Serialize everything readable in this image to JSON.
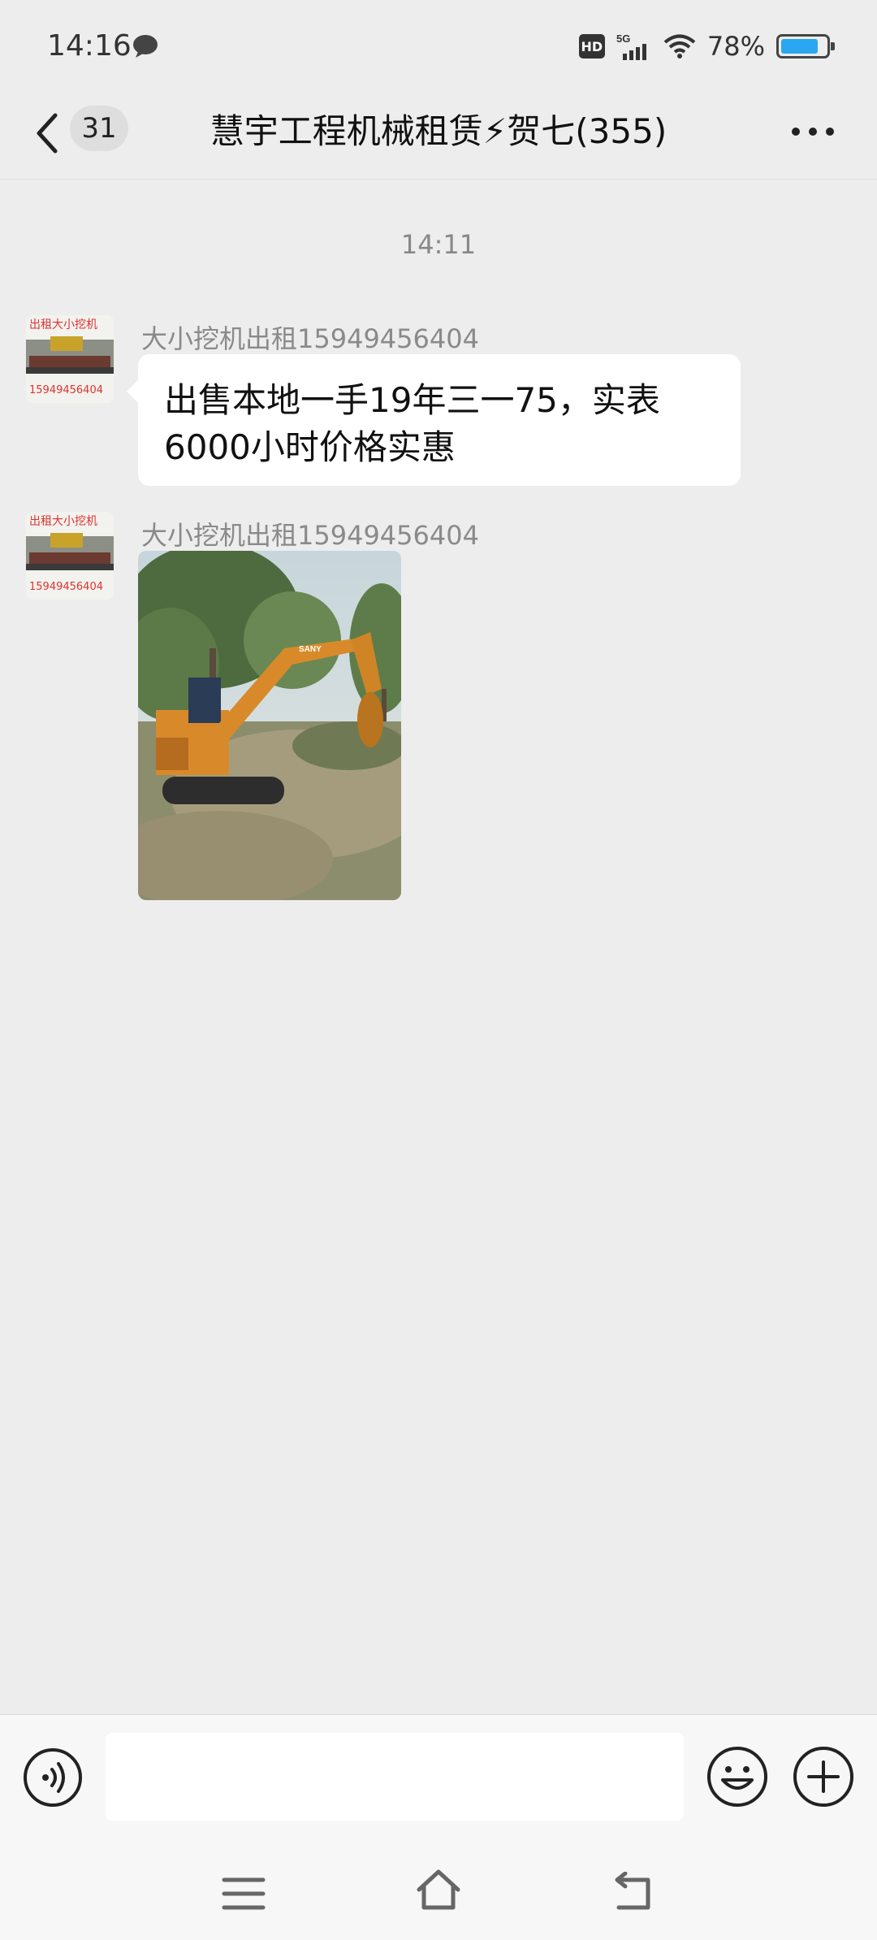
{
  "status_bar": {
    "time": "14:16",
    "network": "5G",
    "hd": "HD",
    "battery": "78%",
    "battery_level": 0.78
  },
  "header": {
    "back_badge": "31",
    "title": "慧宇工程机械租赁⚡贺七(355)",
    "more_icon": "more-dots-icon"
  },
  "chat": {
    "timestamp": "14:11",
    "messages": [
      {
        "sender": "大小挖机出租15949456404",
        "type": "text",
        "text": "出售本地一手19年三一75，实表6000小时价格实惠",
        "avatar_text_top": "出租大小挖机",
        "avatar_text_bottom": "15949456404"
      },
      {
        "sender": "大小挖机出租15949456404",
        "type": "image",
        "image_desc_icon": "excavator-photo",
        "avatar_text_top": "出租大小挖机",
        "avatar_text_bottom": "15949456404"
      }
    ]
  },
  "input_bar": {
    "voice_icon": "voice-icon",
    "emoji_icon": "emoji-icon",
    "plus_icon": "plus-icon",
    "value": ""
  },
  "colors": {
    "background": "#ededed",
    "bubble": "#ffffff",
    "battery": "#2aa7f0",
    "lightning": "#f5b400"
  }
}
